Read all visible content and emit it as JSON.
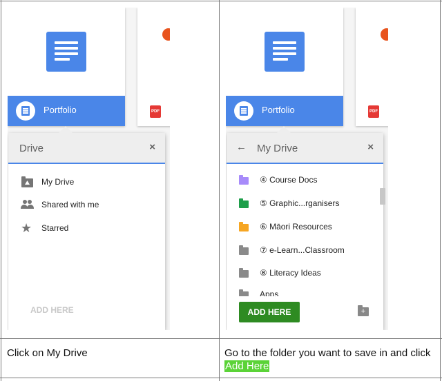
{
  "left": {
    "card_title": "Portfolio",
    "dialog": {
      "title": "Drive",
      "close": "×",
      "items": [
        {
          "label": "My Drive",
          "icon": "my-drive-icon"
        },
        {
          "label": "Shared with me",
          "icon": "people-icon"
        },
        {
          "label": "Starred",
          "icon": "star-icon"
        }
      ],
      "add_here": "ADD HERE"
    },
    "caption": "Click on My Drive"
  },
  "right": {
    "card_title": "Portfolio",
    "dialog": {
      "back": "←",
      "title": "My Drive",
      "close": "×",
      "folders": [
        {
          "label": "④ Course Docs",
          "color": "#a78bfa"
        },
        {
          "label": "⑤ Graphic...rganisers",
          "color": "#1e9e4a"
        },
        {
          "label": "⑥ Māori Resources",
          "color": "#f6a623"
        },
        {
          "label": "⑦ e-Learn...Classroom",
          "color": "#8a8a8a"
        },
        {
          "label": "⑧ Literacy Ideas",
          "color": "#8a8a8a"
        },
        {
          "label": "Apps",
          "color": "#8a8a8a"
        }
      ],
      "add_here": "ADD HERE"
    },
    "caption_prefix": "Go to the folder you want to save in and click ",
    "caption_highlight": "Add Here"
  },
  "colors": {
    "accent": "#4a86e8",
    "button": "#2e8b22",
    "highlight": "#5bd338"
  },
  "card2": {
    "pdf_label": "PDF"
  }
}
